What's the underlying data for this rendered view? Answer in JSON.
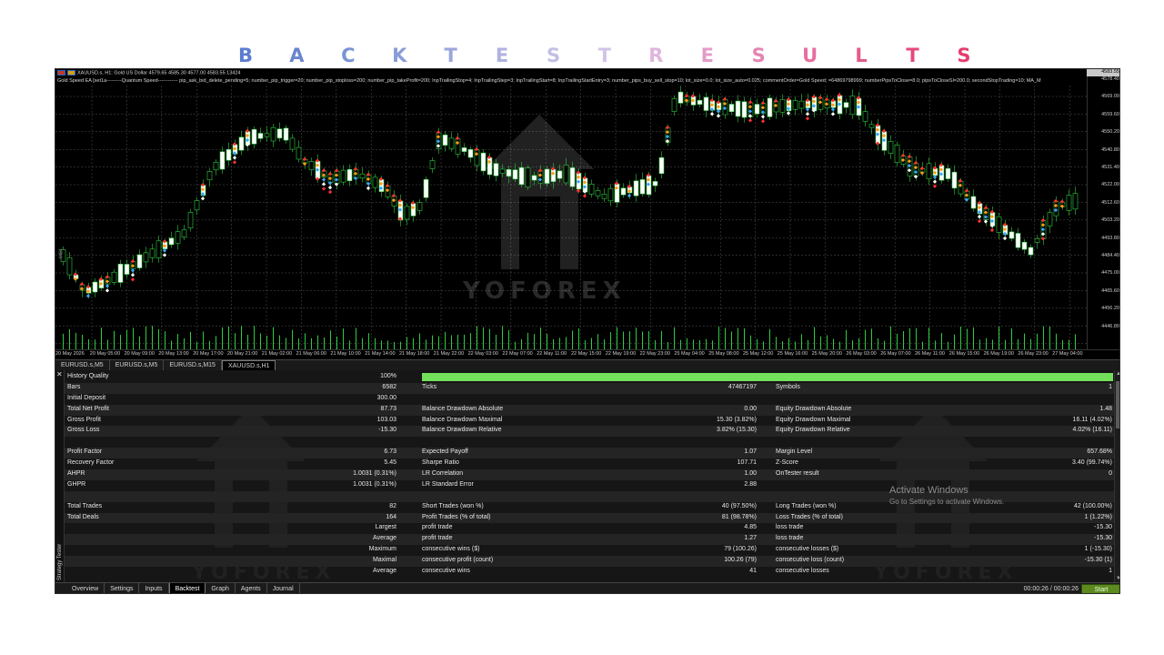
{
  "page_title": {
    "letters": [
      "B",
      "A",
      "C",
      "K",
      "T",
      "E",
      "S",
      "T",
      "R",
      "E",
      "S",
      "U",
      "L",
      "T",
      "S"
    ],
    "colors": [
      "#5c7ccf",
      "#6a86d0",
      "#7a94d4",
      "#8a9cd8",
      "#9aa6dc",
      "#b0b2e0",
      "#c2bfe4",
      "#d2c4e6",
      "#e0b5dd",
      "#e39cc9",
      "#e585b4",
      "#e66f9f",
      "#e65a8b",
      "#e54a7a",
      "#e43f6e"
    ]
  },
  "chart": {
    "header_line1": "XAUUSD.s, H1:  Gold US Dollar  4579.65 4585.30 4577.00 4583.55  13424",
    "header_line2": "Gold Speed EA [set1a---------Quantum Speed------------ pip_ask_bid_delete_pending=5; number_pip_trigger=20; number_pip_stoploss=200; number_pip_takeProfit=200; InpTrailingStop=4; InpTrailingStep=3; InpTrailingStart=8; InpTrailingStartEntry=3; number_pips_buy_sell_stop=10; lot_size=0.0; lot_size_auto=0.025; commentOrder=Gold Speed; =64869798999; numberPipsToClose=8.0; pipsToCloseSl=200.0; secondStopTrading=10; MA_M",
    "price_top": "4583.55",
    "price_labels": [
      "4578.40",
      "4569.00",
      "4559.60",
      "4550.20",
      "4540.80",
      "4531.40",
      "4522.00",
      "4512.60",
      "4503.20",
      "4493.80",
      "4484.40",
      "4475.00",
      "4465.60",
      "4456.20",
      "4446.80"
    ],
    "time_labels": [
      "20 May 2026",
      "20 May 05:00",
      "20 May 09:00",
      "20 May 13:00",
      "20 May 17:00",
      "20 May 21:00",
      "21 May 02:00",
      "21 May 06:00",
      "21 May 10:00",
      "21 May 14:00",
      "21 May 18:00",
      "21 May 22:00",
      "22 May 03:00",
      "22 May 07:00",
      "22 May 11:00",
      "22 May 15:00",
      "22 May 19:00",
      "22 May 23:00",
      "25 May 04:00",
      "25 May 08:00",
      "25 May 12:00",
      "25 May 16:00",
      "25 May 20:00",
      "26 May 03:00",
      "26 May 07:00",
      "26 May 11:00",
      "26 May 15:00",
      "26 May 19:00",
      "26 May 23:00",
      "27 May 04:00"
    ],
    "watermark": "YOFOREX",
    "left_axis_tick": "4494"
  },
  "symbol_tabs": [
    "EURUSD.s,M5",
    "EURUSD.s,M5",
    "EURUSD.s,M15",
    "XAUUSD.s,H1"
  ],
  "tester": {
    "strip_label": "Strategy Tester",
    "quality": {
      "label": "History Quality",
      "value": "100%"
    },
    "row1": {
      "a_label": "Bars",
      "a_value": "6582",
      "b_label": "Ticks",
      "b_value": "47467197",
      "c_label": "Symbols",
      "c_value": "1"
    },
    "initial_deposit": {
      "label": "Initial Deposit",
      "value": "300.00"
    },
    "net_profit": {
      "label": "Total Net Profit",
      "value": "87.73",
      "b_label": "Balance Drawdown Absolute",
      "b_value": "0.00",
      "c_label": "Equity Drawdown Absolute",
      "c_value": "1.48"
    },
    "gross_profit": {
      "label": "Gross Profit",
      "value": "103.03",
      "b_label": "Balance Drawdown Maximal",
      "b_value": "15.30 (3.82%)",
      "c_label": "Equity Drawdown Maximal",
      "c_value": "16.11 (4.02%)"
    },
    "gross_loss": {
      "label": "Gross Loss",
      "value": "-15.30",
      "b_label": "Balance Drawdown Relative",
      "b_value": "3.82% (15.30)",
      "c_label": "Equity Drawdown Relative",
      "c_value": "4.02% (16.11)"
    },
    "profit_factor": {
      "label": "Profit Factor",
      "value": "6.73",
      "b_label": "Expected Payoff",
      "b_value": "1.07",
      "c_label": "Margin Level",
      "c_value": "657.68%"
    },
    "recovery": {
      "label": "Recovery Factor",
      "value": "5.45",
      "b_label": "Sharpe Ratio",
      "b_value": "107.71",
      "c_label": "Z-Score",
      "c_value": "3.40 (99.74%)"
    },
    "ahpr": {
      "label": "AHPR",
      "value": "1.0031 (0.31%)",
      "b_label": "LR Correlation",
      "b_value": "1.00",
      "c_label": "OnTester result",
      "c_value": "0"
    },
    "ghpr": {
      "label": "GHPR",
      "value": "1.0031 (0.31%)",
      "b_label": "LR Standard Error",
      "b_value": "2.88"
    },
    "total_trades": {
      "label": "Total Trades",
      "value": "82",
      "b_label": "Short Trades (won %)",
      "b_value": "40 (97.50%)",
      "c_label": "Long Trades (won %)",
      "c_value": "42 (100.00%)"
    },
    "total_deals": {
      "label": "Total Deals",
      "value": "164",
      "b_label": "Profit Trades (% of total)",
      "b_value": "81 (98.78%)",
      "c_label": "Loss Trades (% of total)",
      "c_value": "1 (1.22%)"
    },
    "largest": {
      "label": "Largest",
      "b_label": "profit trade",
      "b_value": "4.85",
      "c_label": "loss trade",
      "c_value": "-15.30"
    },
    "average": {
      "label": "Average",
      "b_label": "profit trade",
      "b_value": "1.27",
      "c_label": "loss trade",
      "c_value": "-15.30"
    },
    "maximum": {
      "label": "Maximum",
      "b_label": "consecutive wins ($)",
      "b_value": "79 (100.26)",
      "c_label": "consecutive losses ($)",
      "c_value": "1 (-15.30)"
    },
    "maximal": {
      "label": "Maximal",
      "b_label": "consecutive profit (count)",
      "b_value": "100.26 (79)",
      "c_label": "consecutive loss (count)",
      "c_value": "-15.30 (1)"
    },
    "average2": {
      "label": "Average",
      "b_label": "consecutive wins",
      "b_value": "41",
      "c_label": "consecutive losses",
      "c_value": "1"
    }
  },
  "tester_tabs": [
    "Overview",
    "Settings",
    "Inputs",
    "Backtest",
    "Graph",
    "Agents",
    "Journal"
  ],
  "active_tester_tab": "Backtest",
  "timer": "00:00:26 / 00:00:26",
  "start_button": "Start",
  "activate_windows": {
    "title": "Activate Windows",
    "subtitle": "Go to Settings to activate Windows."
  },
  "colors": {
    "bull": "#ffffff",
    "bear": "#000000",
    "candle_outline": "#2ecc40",
    "quality_bar": "#72e05a",
    "start_button": "#5c8a1e"
  }
}
